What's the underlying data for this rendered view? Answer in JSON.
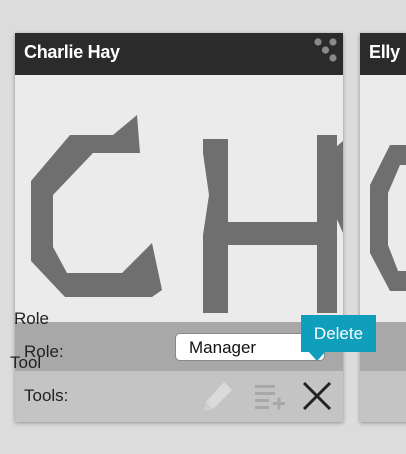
{
  "cards": [
    {
      "name": "Charlie Hay",
      "role_label": "Role:",
      "role_value": "Manager",
      "tools_label": "Tools:",
      "photo_initials": "CH",
      "tools": [
        {
          "name": "edit",
          "icon": "pencil-icon",
          "enabled": false
        },
        {
          "name": "list",
          "icon": "add-list-icon",
          "enabled": false
        },
        {
          "name": "delete",
          "icon": "close-icon",
          "enabled": true
        }
      ],
      "tooltip": "Delete"
    },
    {
      "name": "Elly",
      "role_label": "Role",
      "tools_label": "Tool"
    }
  ],
  "colors": {
    "header_bg": "#2b2b2b",
    "role_row_bg": "#a8a8a8",
    "tools_row_bg": "#c4c4c4",
    "tooltip_bg": "#0f9fbd",
    "icon_gray": "#7a7a7a"
  }
}
